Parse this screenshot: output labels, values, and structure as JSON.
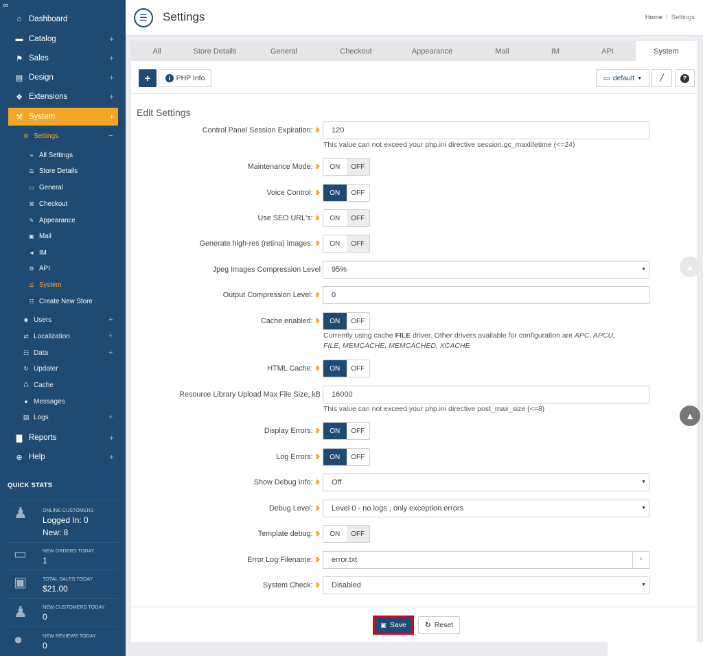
{
  "colors": {
    "sidebar": "#1f4b72",
    "accent": "#f5a623",
    "primary": "#1f4b72",
    "danger": "#e3001b"
  },
  "sidebar": {
    "logo_icon": "logo-icon",
    "menu": [
      {
        "label": "Dashboard",
        "icon": "home-icon"
      },
      {
        "label": "Catalog",
        "icon": "folder-icon"
      },
      {
        "label": "Sales",
        "icon": "flag-icon"
      },
      {
        "label": "Design",
        "icon": "file-icon"
      },
      {
        "label": "Extensions",
        "icon": "puzzle-icon"
      },
      {
        "label": "System",
        "icon": "wrench-icon"
      },
      {
        "label": "Reports",
        "icon": "bar-chart-icon"
      },
      {
        "label": "Help",
        "icon": "lifebuoy-icon"
      }
    ],
    "system_sub": [
      {
        "label": "Settings"
      },
      {
        "label": "Users"
      },
      {
        "label": "Localization"
      },
      {
        "label": "Data"
      },
      {
        "label": "Updater"
      },
      {
        "label": "Cache"
      },
      {
        "label": "Messages"
      },
      {
        "label": "Logs"
      }
    ],
    "settings_sub": [
      {
        "label": "All Settings"
      },
      {
        "label": "Store Details"
      },
      {
        "label": "General"
      },
      {
        "label": "Checkout"
      },
      {
        "label": "Appearance"
      },
      {
        "label": "Mail"
      },
      {
        "label": "IM"
      },
      {
        "label": "API"
      },
      {
        "label": "System"
      },
      {
        "label": "Create New Store"
      }
    ]
  },
  "quick_stats": {
    "title": "QUICK STATS",
    "online": {
      "label": "ONLINE CUSTOMERS",
      "logged_in": "Logged In: 0",
      "new": "New: 8"
    },
    "orders": {
      "label": "NEW ORDERS TODAY",
      "value": "1"
    },
    "sales": {
      "label": "TOTAL SALES TODAY",
      "value": "$21.00"
    },
    "customers": {
      "label": "NEW CUSTOMERS TODAY",
      "value": "0"
    },
    "reviews": {
      "label": "NEW REVIEWS TODAY",
      "value": "0"
    }
  },
  "header": {
    "title": "Settings",
    "breadcrumb": [
      "Home",
      "Settings"
    ]
  },
  "tabs": [
    "All",
    "Store Details",
    "General",
    "Checkout",
    "Appearance",
    "Mail",
    "IM",
    "API",
    "System"
  ],
  "active_tab": "System",
  "toolbar": {
    "add_label": "+",
    "phpinfo_label": "PHP Info",
    "template_select": "default"
  },
  "form": {
    "title": "Edit Settings",
    "session_expiration": {
      "label": "Control Panel Session Expiration:",
      "value": "120",
      "help": "This value can not exceed your php.ini directive session.gc_maxlifetime (<=24)"
    },
    "maintenance_mode": {
      "label": "Maintenance Mode:",
      "state": "OFF"
    },
    "voice_control": {
      "label": "Voice Control:",
      "state": "ON"
    },
    "seo_urls": {
      "label": "Use SEO URL's:",
      "state": "OFF"
    },
    "retina_images": {
      "label": "Generate high-res (retina) images:",
      "state": "OFF"
    },
    "jpeg_compression": {
      "label": "Jpeg Images Compression Level",
      "value": "95%"
    },
    "output_compression": {
      "label": "Output Compression Level:",
      "value": "0"
    },
    "cache_enabled": {
      "label": "Cache enabled:",
      "state": "ON",
      "help_prefix": "Currently using cache ",
      "help_driver": "FILE",
      "help_mid": " driver. Other drivers available for configuration are ",
      "help_list1": "APC, APCU,",
      "help_list2": "FILE, MEMCACHE, MEMCACHED, XCACHE"
    },
    "html_cache": {
      "label": "HTML Cache:",
      "state": "ON"
    },
    "upload_max": {
      "label": "Resource Library Upload Max File Size, kB",
      "value": "16000",
      "help": "This value can not exceed your php.ini directive post_max_size (<=8)"
    },
    "display_errors": {
      "label": "Display Errors:",
      "state": "ON"
    },
    "log_errors": {
      "label": "Log Errors:",
      "state": "ON"
    },
    "debug_info": {
      "label": "Show Debug Info:",
      "value": "Off"
    },
    "debug_level": {
      "label": "Debug Level:",
      "value": "Level 0 - no logs , only exception errors"
    },
    "template_debug": {
      "label": "Template debug:",
      "state": "OFF"
    },
    "error_log": {
      "label": "Error Log Filename:",
      "value": "error.txt",
      "required": "*"
    },
    "system_check": {
      "label": "System Check:",
      "value": "Disabled"
    },
    "on_label": "ON",
    "off_label": "OFF"
  },
  "buttons": {
    "save": "Save",
    "reset": "Reset"
  }
}
